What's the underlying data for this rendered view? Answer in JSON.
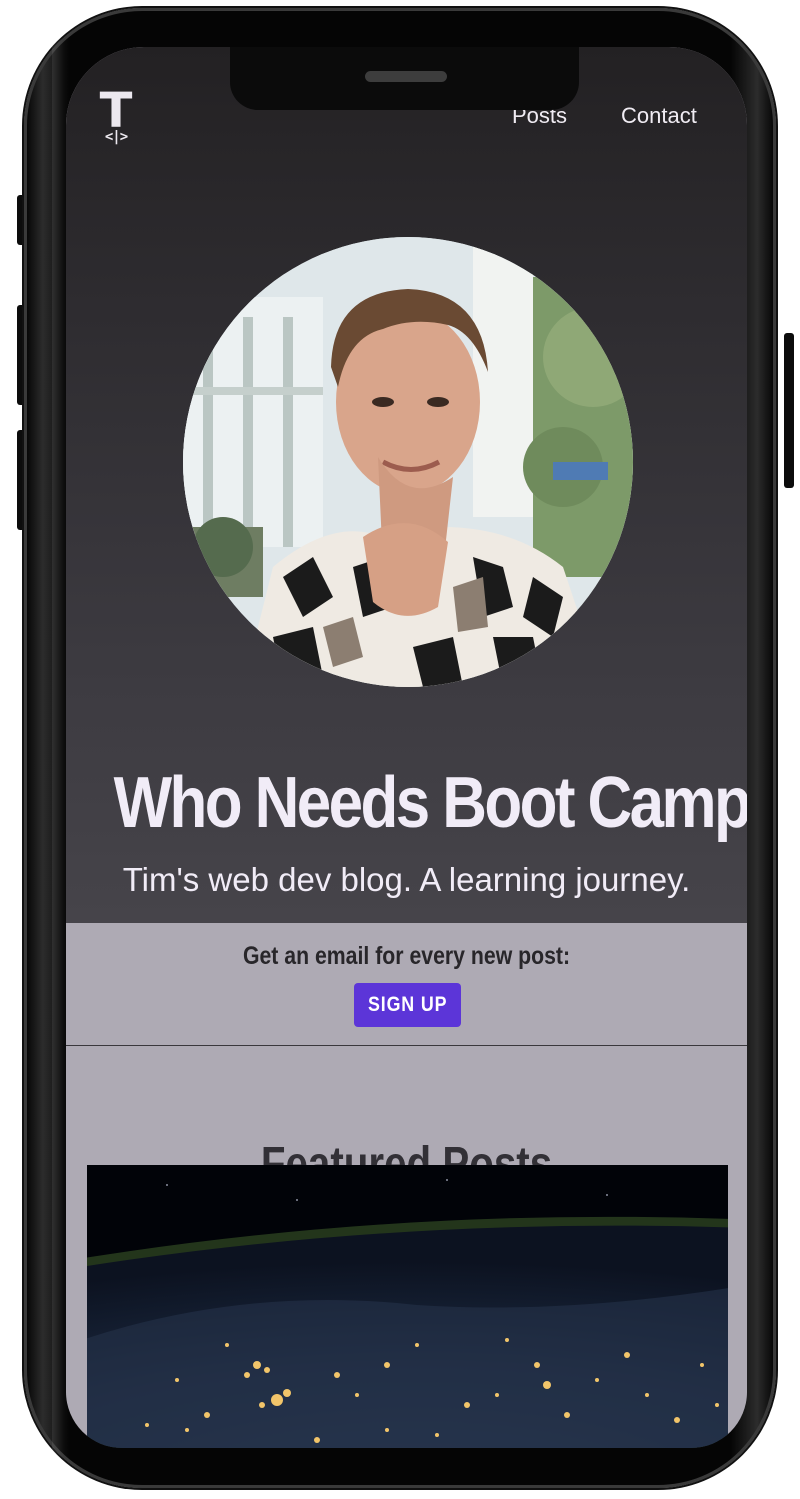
{
  "logo": {
    "letter": "T",
    "sub": "<|>"
  },
  "nav": {
    "items": [
      "Posts",
      "Contact"
    ]
  },
  "hero": {
    "title": "Who Needs Boot Camp?",
    "subtitle": "Tim's web dev blog. A learning journey."
  },
  "subscribe": {
    "prompt": "Get an email for every new post:",
    "button_label": "SIGN UP"
  },
  "featured": {
    "title": "Featured Posts"
  },
  "colors": {
    "accent": "#5c35d8",
    "hero_bg": "#3c3a40",
    "page_bg": "#aeaab4",
    "hero_text": "#f1ecf7"
  },
  "icons": [
    "profile-photo",
    "earth-at-night-image"
  ]
}
